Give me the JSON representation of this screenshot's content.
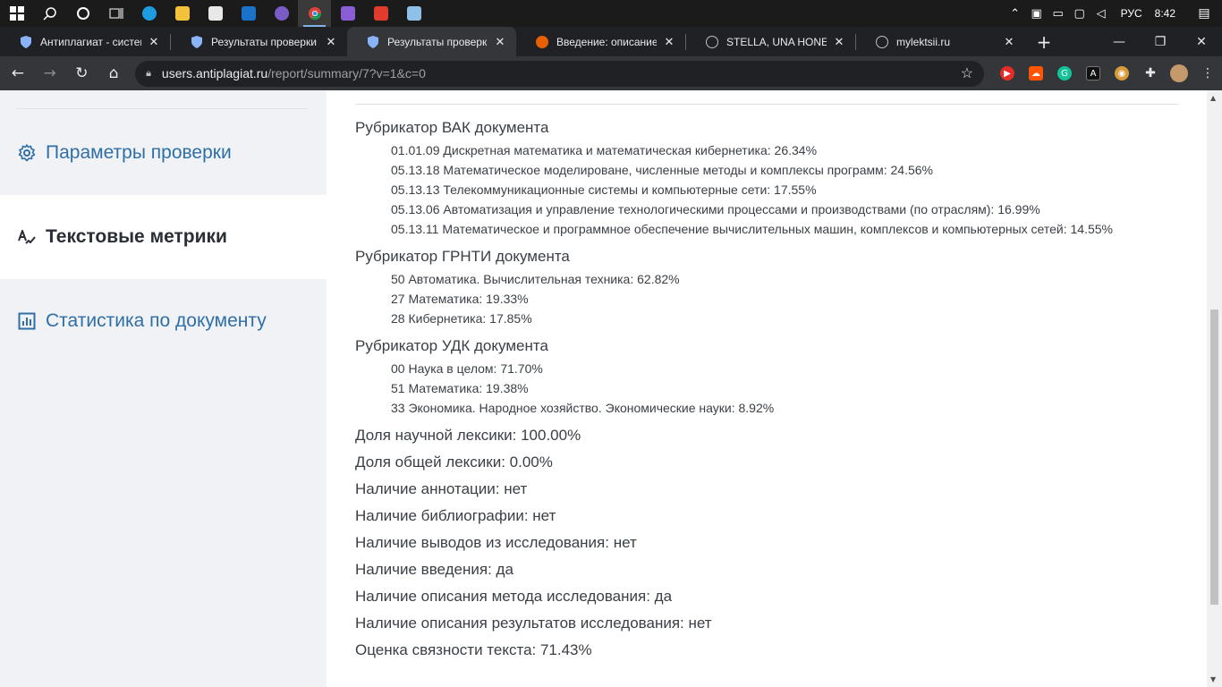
{
  "taskbar": {
    "clock": "8:42",
    "language": "РУС"
  },
  "tabs": [
    {
      "title": "Антиплагиат - система",
      "favicon": "shield-icon",
      "active": false
    },
    {
      "title": "Результаты проверки -",
      "favicon": "shield-icon",
      "active": false
    },
    {
      "title": "Результаты проверки -",
      "favicon": "shield-icon",
      "active": true
    },
    {
      "title": "Введение: описание ре",
      "favicon": "firefox-icon",
      "active": false
    },
    {
      "title": "STELLA, UNA HONEYPO",
      "favicon": "globe-icon",
      "active": false
    },
    {
      "title": "mylektsii.ru",
      "favicon": "globe-icon",
      "active": false
    }
  ],
  "address": {
    "host": "users.antiplagiat.ru",
    "path": "/report/summary/7?v=1&c=0"
  },
  "sidebar": {
    "items": [
      {
        "label": "Параметры проверки",
        "icon": "gear-icon",
        "active": false
      },
      {
        "label": "Текстовые метрики",
        "icon": "text-metrics-icon",
        "active": true
      },
      {
        "label": "Статистика по документу",
        "icon": "bar-chart-icon",
        "active": false
      }
    ]
  },
  "content": {
    "vak": {
      "heading": "Рубрикатор ВАК документа",
      "items": [
        "01.01.09 Дискретная математика и математическая кибернетика: 26.34%",
        "05.13.18 Математическое моделироване, численные методы и комплексы программ: 24.56%",
        "05.13.13 Телекоммуникационные системы и компьютерные сети: 17.55%",
        "05.13.06 Автоматизация и управление технологическими процессами и производствами (по отраслям): 16.99%",
        "05.13.11 Математическое и программное обеспечение вычислительных машин, комплексов и компьютерных сетей: 14.55%"
      ]
    },
    "grnti": {
      "heading": "Рубрикатор ГРНТИ документа",
      "items": [
        "50 Автоматика. Вычислительная техника: 62.82%",
        "27 Математика: 19.33%",
        "28 Кибернетика: 17.85%"
      ]
    },
    "udk": {
      "heading": "Рубрикатор УДК документа",
      "items": [
        "00 Наука в целом: 71.70%",
        "51 Математика: 19.38%",
        "33 Экономика. Народное хозяйство. Экономические науки: 8.92%"
      ]
    },
    "metrics": [
      "Доля научной лексики: 100.00%",
      "Доля общей лексики: 0.00%",
      "Наличие аннотации: нет",
      "Наличие библиографии: нет",
      "Наличие выводов из исследования: нет",
      "Наличие введения: да",
      "Наличие описания метода исследования: да",
      "Наличие описания результатов исследования: нет",
      "Оценка связности текста: 71.43%"
    ]
  },
  "colors": {
    "accent": "#2f6fa8",
    "sidebar_bg": "#f0f2f5",
    "text": "#3a3f45"
  }
}
